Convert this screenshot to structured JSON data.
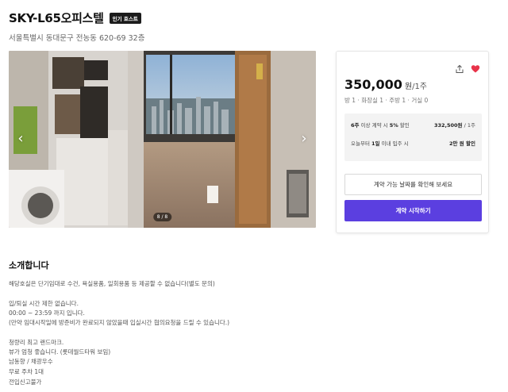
{
  "listing": {
    "title": "SKY-L65오피스텔",
    "badge": "인기 호스트",
    "address": "서울특별시 동대문구 전농동 620-69 32층"
  },
  "gallery": {
    "counter": "8 / 8",
    "prev_icon": "chevron-left-icon",
    "next_icon": "chevron-right-icon"
  },
  "booking": {
    "price": "350,000",
    "price_unit": "원",
    "price_period": "/1주",
    "rooms": "방 1 · 화장실 1 · 주방 1 · 거실 0",
    "discount_label_bold": "6주",
    "discount_label_mid": " 이상 계약 시 ",
    "discount_label_pct": "5%",
    "discount_label_end": " 할인",
    "discount_value": "332,500원",
    "discount_value_unit": " / 1주",
    "movein_label_start": "오늘부터 ",
    "movein_label_bold": "1일",
    "movein_label_end": " 이내 입주 시",
    "movein_value": "2만 원 할인",
    "check_dates_label": "계약 가능 날짜를 확인해 보세요",
    "start_contract_label": "계약 시작하기",
    "share_icon": "share-icon",
    "heart_icon": "heart-icon",
    "accent_color": "#5b3fe0",
    "heart_color": "#e8334a"
  },
  "intro": {
    "title": "소개합니다",
    "lines": [
      "해당호실은 단기임대로 수건, 욕실용품, 일회용품 등 제공할 수 없습니다(별도 문의)",
      "입/퇴실 시간 제한 없습니다.",
      "00:00 ~ 23:59 까지 입니다.",
      "(만약 임대시작일에 방준비가 완료되지 않았을때 입실시간 협의요청을 드릴 수 있습니다.)",
      "청량리 최고 랜드마크.",
      "뷰가 엄청 좋습니다. (롯데월드타워 보임)",
      "남동향 / 채광우수",
      "무료 주차 1대",
      "전입신고불가"
    ]
  }
}
